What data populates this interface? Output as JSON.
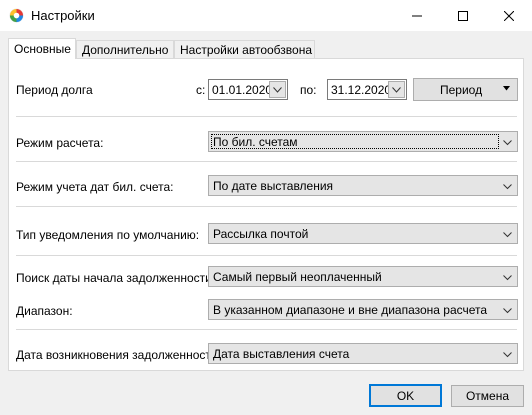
{
  "window": {
    "title": "Настройки",
    "icon": "app-logo-icon",
    "controls": [
      "minimize-icon",
      "maximize-icon",
      "close-icon"
    ]
  },
  "tabs": [
    {
      "label": "Основные",
      "active": true
    },
    {
      "label": "Дополнительно",
      "active": false
    },
    {
      "label": "Настройки автообзвона",
      "active": false
    }
  ],
  "debt_period": {
    "label": "Период долга",
    "from_label": "с:",
    "from_value": "01.01.2020",
    "to_label": "по:",
    "to_value": "31.12.2020",
    "period_button": "Период"
  },
  "calc_mode": {
    "label": "Режим расчета:",
    "value": "По бил. счетам"
  },
  "date_mode": {
    "label": "Режим учета дат бил. счета:",
    "value": "По дате выставления"
  },
  "notify_type": {
    "label": "Тип уведомления по умолчанию:",
    "value": "Рассылка почтой"
  },
  "debt_search": {
    "label": "Поиск даты начала задолженности:",
    "value": "Самый первый неоплаченный"
  },
  "range": {
    "label": "Диапазон:",
    "value": "В указанном диапазоне и вне диапазона расчета"
  },
  "debt_origin": {
    "label": "Дата возникновения задолженности:",
    "value": "Дата выставления счета"
  },
  "footer": {
    "ok": "OK",
    "cancel": "Отмена"
  }
}
